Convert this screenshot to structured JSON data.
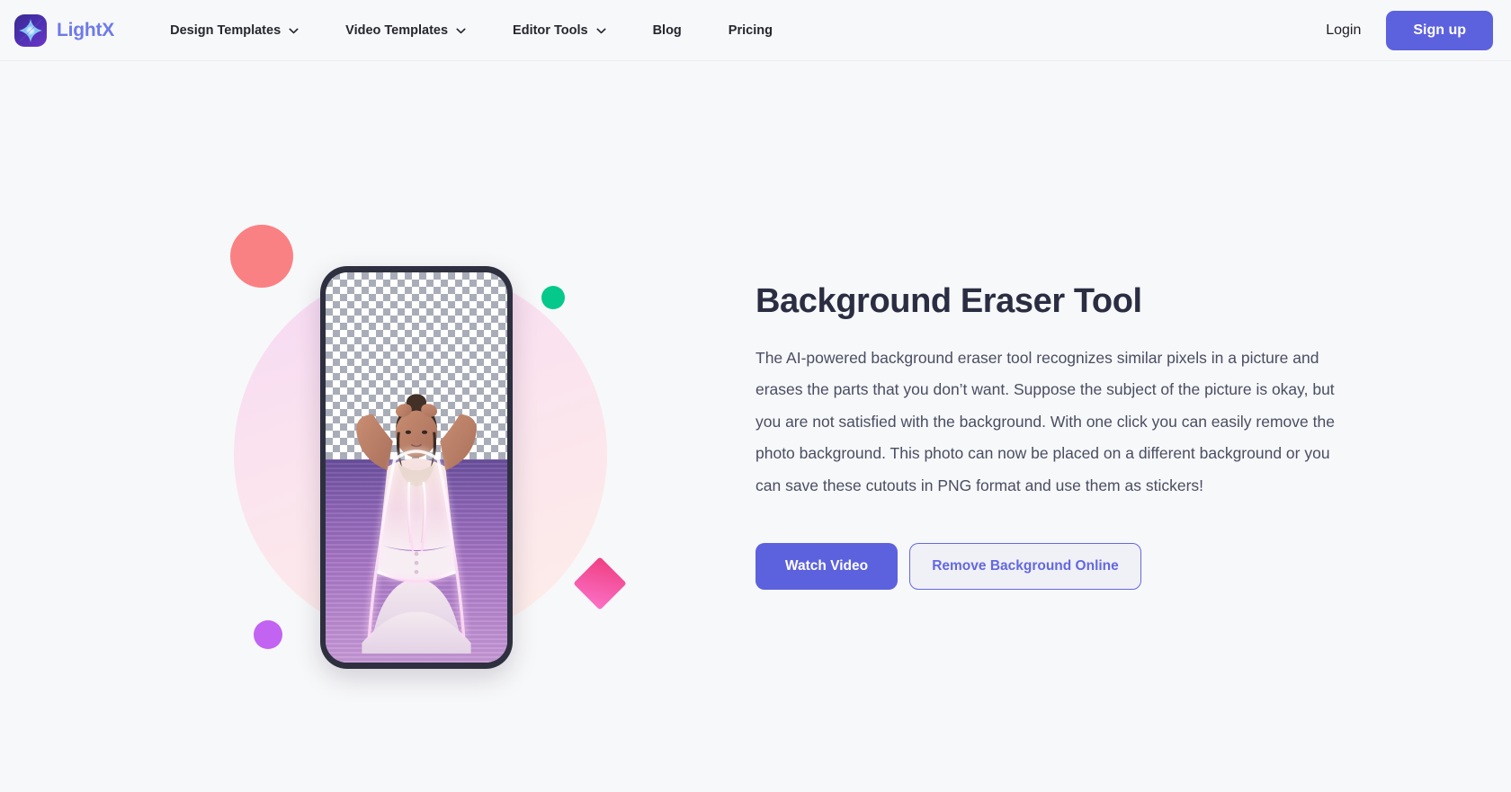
{
  "navbar": {
    "brand": {
      "name": "LightX",
      "logo_icon": "lightx-spark-logo"
    },
    "links": [
      {
        "label": "Design Templates",
        "has_dropdown": true,
        "icon": "chevron-down-icon"
      },
      {
        "label": "Video Templates",
        "has_dropdown": true,
        "icon": "chevron-down-icon"
      },
      {
        "label": "Editor Tools",
        "has_dropdown": true,
        "icon": "chevron-down-icon"
      },
      {
        "label": "Blog",
        "has_dropdown": false
      },
      {
        "label": "Pricing",
        "has_dropdown": false
      }
    ],
    "login_label": "Login",
    "signup_label": "Sign up"
  },
  "hero": {
    "title": "Background Eraser Tool",
    "description": "The AI-powered background eraser tool recognizes similar pixels in a picture and erases the parts that you don’t want. Suppose the subject of the picture is okay, but you are not satisfied with the background. With one click you can easily remove the photo background. This photo can now be placed on a different background or you can save these cutouts in PNG format and use them as stickers!",
    "primary_cta": "Watch Video",
    "secondary_cta": "Remove Background Online",
    "visual": {
      "phone_mockup_alt": "phone showing photo with background partially erased to transparent checkerboard",
      "shapes": [
        {
          "name": "red-circle",
          "color": "#fa8183"
        },
        {
          "name": "green-circle",
          "color": "#05c98b"
        },
        {
          "name": "purple-circle",
          "color": "#c263f2"
        },
        {
          "name": "pink-diamond",
          "color": "#ef3f82"
        },
        {
          "name": "pink-blob",
          "color": "#f6d9f4"
        }
      ]
    }
  },
  "colors": {
    "accent": "#5c61de",
    "brand_text": "#6e7ae8",
    "heading": "#2b2d42",
    "body_text": "#4a4d63",
    "page_bg": "#f7f8f9"
  }
}
